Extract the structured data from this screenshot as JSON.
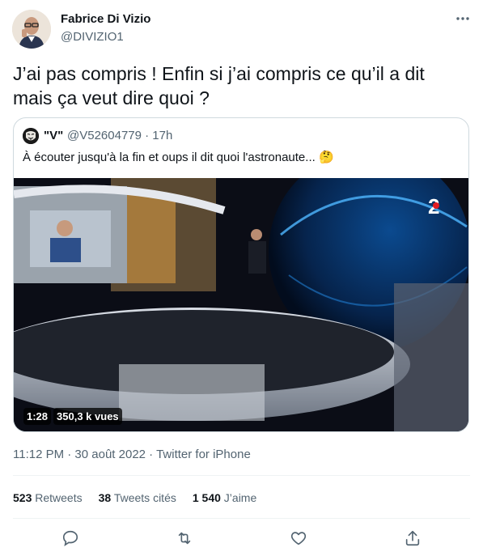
{
  "author": {
    "name": "Fabrice Di Vizio",
    "handle": "@DIVIZIO1"
  },
  "tweet": {
    "text": "J’ai pas compris ! Enfin si j’ai compris ce qu’il a dit\nmais ça veut dire quoi ?"
  },
  "quoted": {
    "name": "\"V\"",
    "handle_time": "@V52604779 · 17h",
    "text": "À écouter jusqu'à la fin et oups il dit quoi l'astronaute...",
    "emoji": "🤔",
    "video": {
      "duration": "1:28",
      "views": "350,3 k vues",
      "channel_logo": "2"
    }
  },
  "meta": {
    "timestamp": "11:12 PM · 30 août 2022 · Twitter for iPhone"
  },
  "stats": {
    "retweets_count": "523",
    "retweets_label": "Retweets",
    "quotes_count": "38",
    "quotes_label": "Tweets cités",
    "likes_count": "1 540",
    "likes_label": "J’aime"
  },
  "icons": [
    "more-icon",
    "reply-icon",
    "retweet-icon",
    "like-icon",
    "share-icon"
  ],
  "colors": {
    "text": "#0f1419",
    "secondary": "#536471",
    "border": "#cfd9de"
  }
}
